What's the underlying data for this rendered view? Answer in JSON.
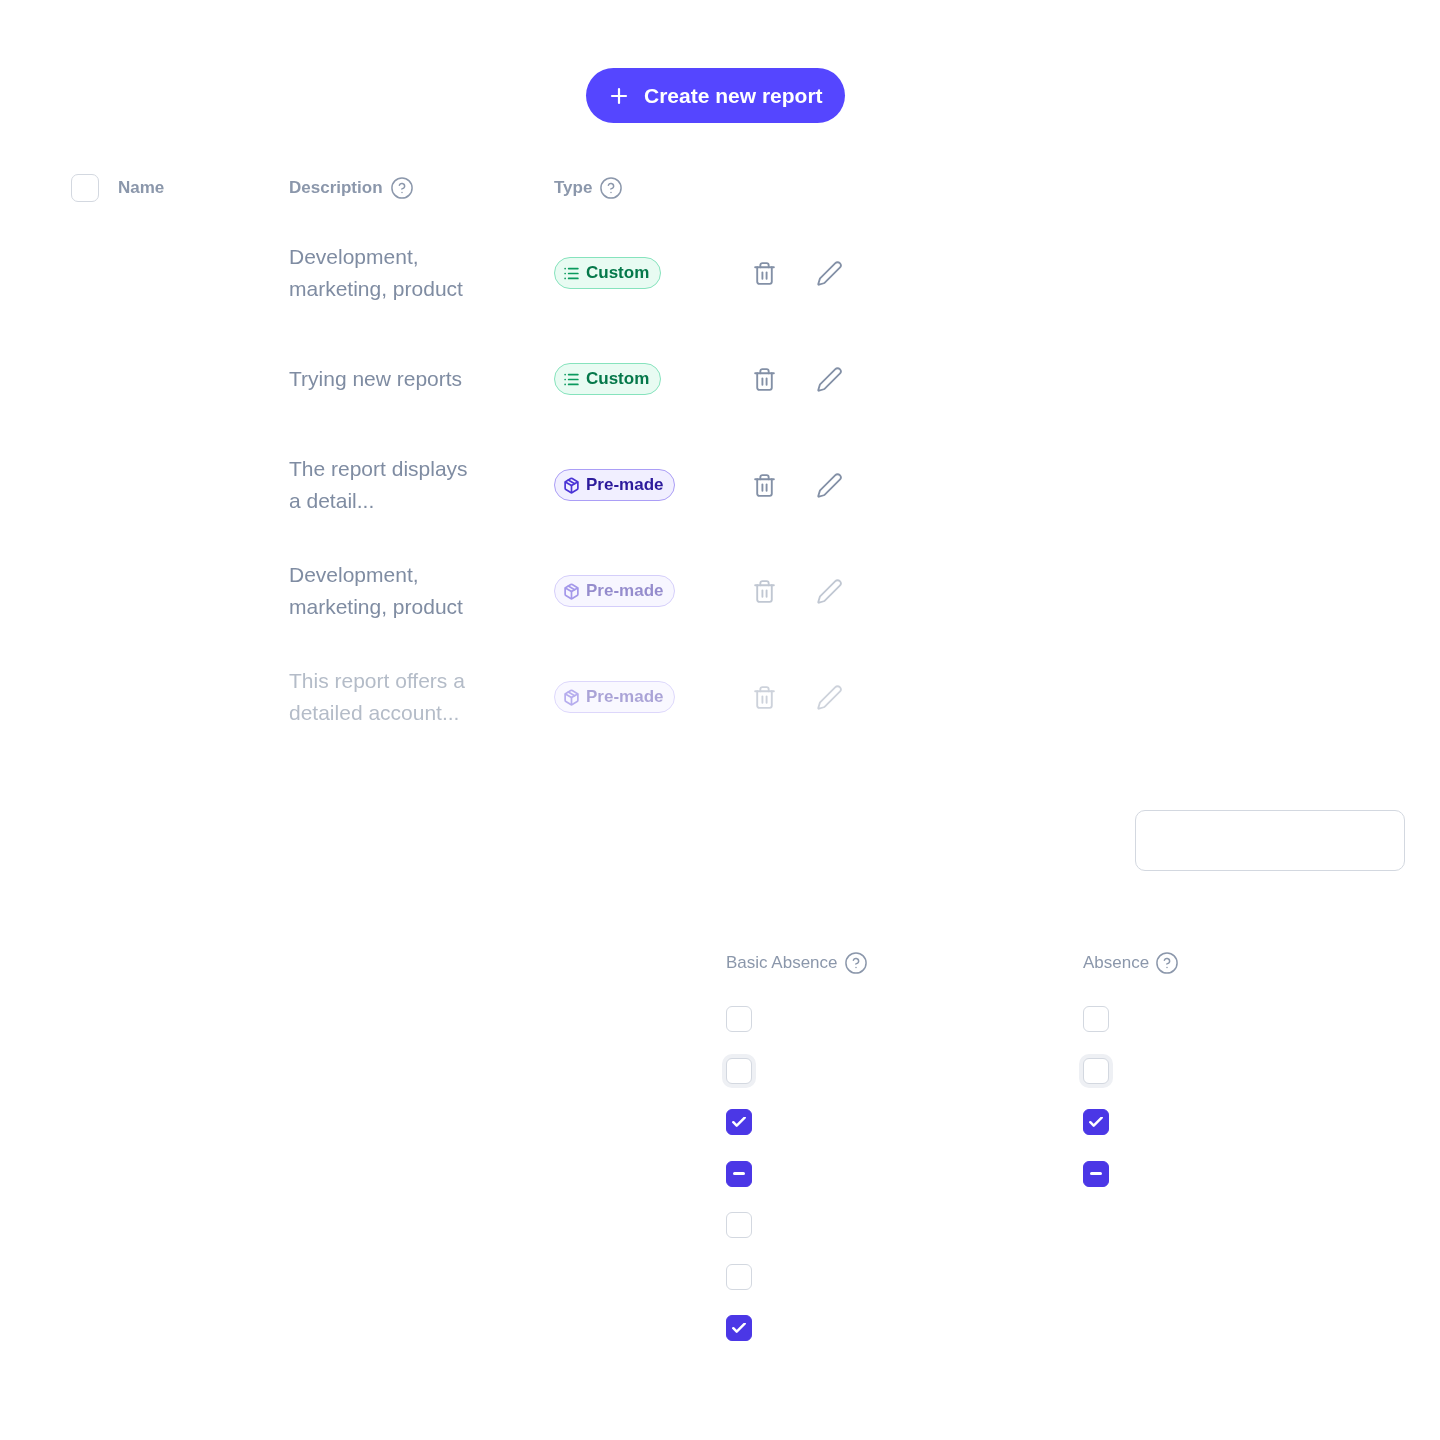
{
  "create_button": {
    "label": "Create new report"
  },
  "table": {
    "select_all": {
      "checked": false
    },
    "columns": [
      {
        "label": "Name",
        "help": false
      },
      {
        "label": "Description",
        "help": true
      },
      {
        "label": "Type",
        "help": true
      }
    ],
    "rows": [
      {
        "kind": "normal",
        "description": "Development, marketing, product",
        "type": {
          "kind": "custom",
          "label": "Custom"
        }
      },
      {
        "kind": "normal",
        "description": "Trying new reports",
        "type": {
          "kind": "custom",
          "label": "Custom"
        }
      },
      {
        "kind": "normal",
        "description": "The report displays a detail...",
        "type": {
          "kind": "premade",
          "label": "Pre-made"
        }
      },
      {
        "kind": "dimmed",
        "description": "Development, marketing, product",
        "type": {
          "kind": "premade",
          "label": "Pre-made"
        }
      },
      {
        "kind": "faint",
        "description": "This report offers a detailed account...",
        "type": {
          "kind": "premade",
          "label": "Pre-made"
        }
      }
    ]
  },
  "checkbox_columns": [
    {
      "title": "Basic Absence",
      "boxes": [
        {
          "kind": "default",
          "checked": false
        },
        {
          "kind": "focused",
          "checked": false
        },
        {
          "kind": "default",
          "checked": true
        },
        {
          "kind": "indeterminate",
          "checked": true
        },
        {
          "kind": "default",
          "checked": false
        },
        {
          "kind": "default",
          "checked": false
        },
        {
          "kind": "default",
          "checked": true
        }
      ]
    },
    {
      "title": "Absence",
      "boxes": [
        {
          "kind": "default",
          "checked": false
        },
        {
          "kind": "focused",
          "checked": false
        },
        {
          "kind": "default",
          "checked": true
        },
        {
          "kind": "indeterminate",
          "checked": true
        }
      ]
    }
  ]
}
